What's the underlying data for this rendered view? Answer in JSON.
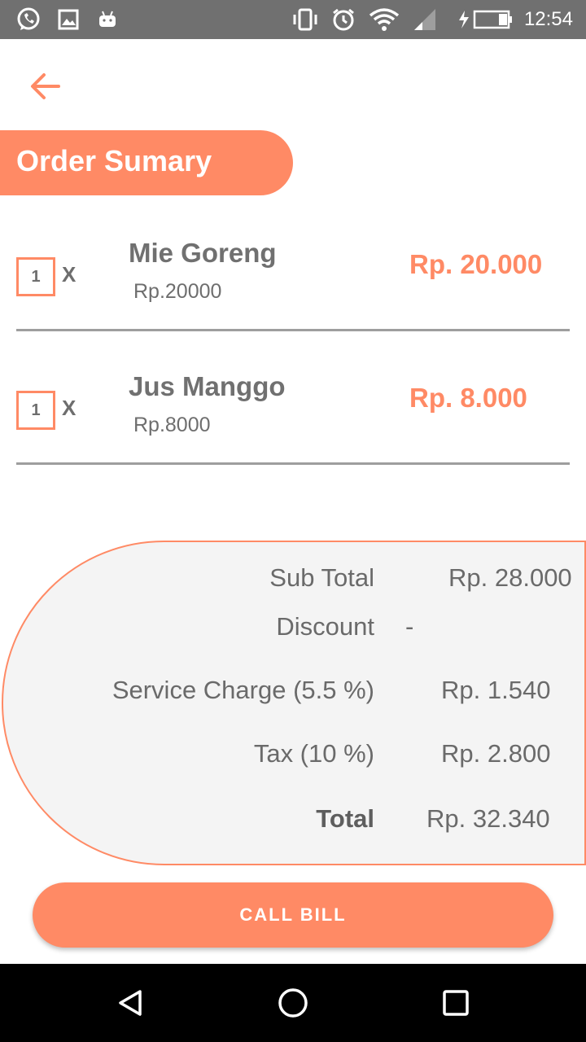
{
  "status_bar": {
    "time": "12:54",
    "icons": [
      "whatsapp-icon",
      "image-icon",
      "android-icon",
      "vibrate-icon",
      "alarm-icon",
      "wifi-icon",
      "signal-icon",
      "battery-charging-icon"
    ]
  },
  "header": {
    "back_icon": "arrow-left-icon",
    "title": "Order Sumary"
  },
  "order_items": [
    {
      "qty": "1",
      "x_label": "X",
      "name": "Mie Goreng",
      "unit_price": "Rp.20000",
      "price": "Rp. 20.000"
    },
    {
      "qty": "1",
      "x_label": "X",
      "name": "Jus Manggo",
      "unit_price": "Rp.8000",
      "price": "Rp. 8.000"
    }
  ],
  "summary": {
    "subtotal_label": "Sub Total",
    "subtotal_value": "Rp. 28.000",
    "discount_label": "Discount",
    "discount_value": "-",
    "service_label": "Service Charge (5.5 %)",
    "service_value": "Rp. 1.540",
    "tax_label": "Tax (10 %)",
    "tax_value": "Rp. 2.800",
    "total_label": "Total",
    "total_value": "Rp. 32.340"
  },
  "actions": {
    "call_bill_label": "CALL BILL"
  },
  "colors": {
    "accent": "#ff8a65",
    "status_bar": "#707070",
    "summary_bg": "#f4f4f4"
  },
  "nav_bar": {
    "icons": [
      "back-triangle-icon",
      "home-circle-icon",
      "recents-square-icon"
    ]
  }
}
